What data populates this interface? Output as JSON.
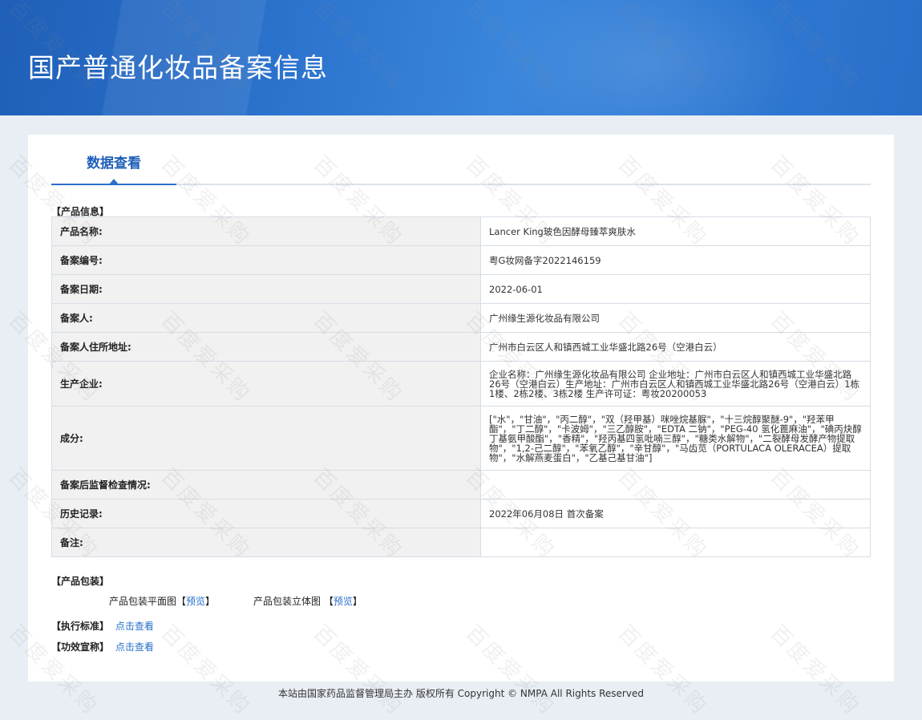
{
  "banner": {
    "title": "国产普通化妆品备案信息"
  },
  "tabs": [
    {
      "label": "数据查看"
    }
  ],
  "sections": {
    "product_info": "【产品信息】",
    "package": "【产品包装】",
    "standard": "【执行标准】",
    "efficacy": "【功效宣称】"
  },
  "product_rows": [
    {
      "label": "产品名称:",
      "value": "Lancer King玻色因酵母臻萃爽肤水"
    },
    {
      "label": "备案编号:",
      "value": "粤G妆网备字2022146159"
    },
    {
      "label": "备案日期:",
      "value": "2022-06-01"
    },
    {
      "label": "备案人:",
      "value": "广州缘生源化妆品有限公司"
    },
    {
      "label": "备案人住所地址:",
      "value": "广州市白云区人和镇西城工业华盛北路26号（空港白云）"
    },
    {
      "label": "生产企业:",
      "value": "企业名称：广州缘生源化妆品有限公司 企业地址：广州市白云区人和镇西城工业华盛北路26号（空港白云）生产地址：广州市白云区人和镇西城工业华盛北路26号（空港白云）1栋1楼、2栋2楼、3栋2楼 生产许可证：粤妆20200053"
    },
    {
      "label": "成分:",
      "value": "[\"水\"，\"甘油\"，\"丙二醇\"，\"双（羟甲基）咪唑烷基脲\"，\"十三烷醇聚醚-9\"，\"羟苯甲酯\"，\"丁二醇\"，\"卡波姆\"，\"三乙醇胺\"，\"EDTA 二钠\"，\"PEG-40 氢化蓖麻油\"，\"碘丙炔醇丁基氨甲酸酯\"，\"香精\"，\"羟丙基四氢吡喃三醇\"，\"糖类水解物\"，\"二裂酵母发酵产物提取物\"，\"1,2-己二醇\"，\"苯氧乙醇\"，\"辛甘醇\"，\"马齿苋（PORTULACA OLERACEA）提取物\"，\"水解燕麦蛋白\"，\"乙基己基甘油\"]"
    },
    {
      "label": "备案后监督检查情况:",
      "value": ""
    },
    {
      "label": "历史记录:",
      "value": "2022年06月08日 首次备案"
    },
    {
      "label": "备注:",
      "value": ""
    }
  ],
  "package": {
    "flat_label": "产品包装平面图",
    "flat_bracket_open": "【",
    "flat_link": "预览",
    "flat_bracket_close": "】",
    "solid_label": "产品包装立体图",
    "solid_bracket_open": "【",
    "solid_link": "预览",
    "solid_bracket_close": "】"
  },
  "standard_link": "点击查看",
  "efficacy_link": "点击查看",
  "footer": "本站由国家药品监督管理局主办 版权所有 Copyright © NMPA All Rights Reserved",
  "watermark": "百度爱采购",
  "colors": {
    "banner": "#2a6fca",
    "tab_text": "#1f5fb8",
    "link": "#2a6fca",
    "label_bg": "#f1f1f1"
  }
}
